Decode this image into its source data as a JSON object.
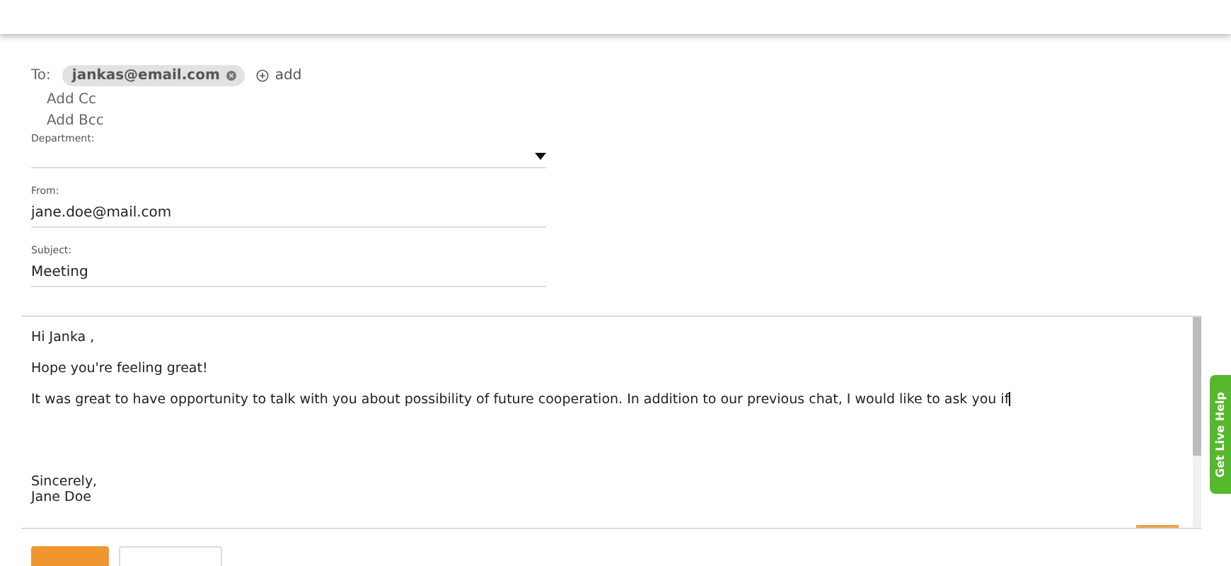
{
  "to": {
    "label": "To:",
    "recipients": [
      {
        "email": "jankas@email.com"
      }
    ],
    "add": "add"
  },
  "add_cc": "Add Cc",
  "add_bcc": "Add Bcc",
  "department": {
    "label": "Department:"
  },
  "from": {
    "label": "From:",
    "value": "jane.doe@mail.com"
  },
  "subject": {
    "label": "Subject:",
    "value": "Meeting"
  },
  "body": {
    "paragraphs": [
      "Hi Janka ,",
      "Hope you're feeling great!",
      "It was great to have opportunity to talk with you about possibility of future cooperation. In addition to our previous chat, I would like to ask you if"
    ],
    "signature": [
      "Sincerely,",
      "Jane Doe"
    ]
  },
  "live_help": "Get Live Help"
}
